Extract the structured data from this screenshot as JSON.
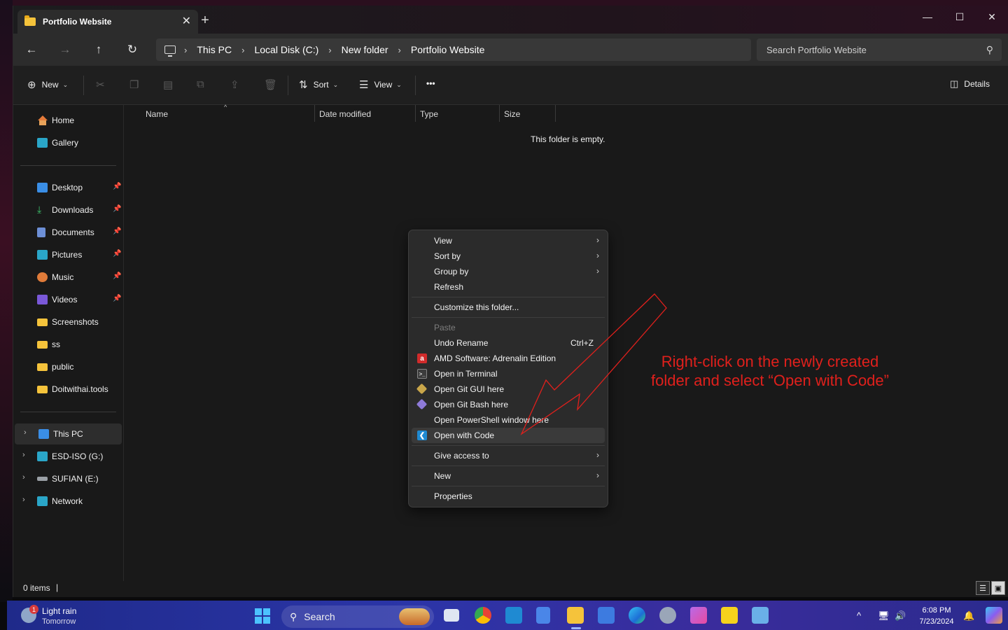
{
  "window": {
    "tab_title": "Portfolio Website",
    "tab_close": "✕",
    "new_tab": "+",
    "controls": {
      "minimize": "—",
      "maximize": "☐",
      "close": "✕"
    }
  },
  "nav": {
    "back": "←",
    "forward": "→",
    "up": "↑",
    "refresh": "↻",
    "breadcrumbs": [
      "This PC",
      "Local Disk (C:)",
      "New folder",
      "Portfolio Website"
    ],
    "crumb_sep": "›",
    "search_placeholder": "Search Portfolio Website",
    "search_icon": "search-icon"
  },
  "toolbar": {
    "new_label": "New",
    "sort_label": "Sort",
    "view_label": "View",
    "more_label": "•••",
    "details_label": "Details"
  },
  "sidebar": {
    "top": [
      {
        "label": "Home",
        "icon": "home-icon"
      },
      {
        "label": "Gallery",
        "icon": "gallery-icon"
      }
    ],
    "quick": [
      {
        "label": "Desktop",
        "pinned": true
      },
      {
        "label": "Downloads",
        "pinned": true
      },
      {
        "label": "Documents",
        "pinned": true
      },
      {
        "label": "Pictures",
        "pinned": true
      },
      {
        "label": "Music",
        "pinned": true
      },
      {
        "label": "Videos",
        "pinned": true
      },
      {
        "label": "Screenshots",
        "pinned": false
      },
      {
        "label": "ss",
        "pinned": false
      },
      {
        "label": "public",
        "pinned": false
      },
      {
        "label": "Doitwithai.tools",
        "pinned": false
      }
    ],
    "drives": [
      {
        "label": "This PC",
        "selected": true
      },
      {
        "label": "ESD-ISO (G:)",
        "selected": false
      },
      {
        "label": "SUFIAN (E:)",
        "selected": false
      },
      {
        "label": "Network",
        "selected": false
      }
    ]
  },
  "columns": [
    "Name",
    "Date modified",
    "Type",
    "Size"
  ],
  "empty_message": "This folder is empty.",
  "status": {
    "items": "0 items",
    "cursor": "|"
  },
  "context_menu": {
    "items": [
      {
        "label": "View",
        "submenu": true
      },
      {
        "label": "Sort by",
        "submenu": true
      },
      {
        "label": "Group by",
        "submenu": true
      },
      {
        "label": "Refresh"
      },
      {
        "label": "Customize this folder..."
      },
      {
        "label": "Paste",
        "disabled": true
      },
      {
        "label": "Undo Rename",
        "shortcut": "Ctrl+Z"
      },
      {
        "label": "AMD Software: Adrenalin Edition",
        "icon": "amd-icon"
      },
      {
        "label": "Open in Terminal",
        "icon": "terminal-icon"
      },
      {
        "label": "Open Git GUI here",
        "icon": "git-icon"
      },
      {
        "label": "Open Git Bash here",
        "icon": "git-icon"
      },
      {
        "label": "Open PowerShell window here"
      },
      {
        "label": "Open with Code",
        "icon": "vscode-icon"
      },
      {
        "label": "Give access to",
        "submenu": true
      },
      {
        "label": "New",
        "submenu": true
      },
      {
        "label": "Properties"
      }
    ]
  },
  "annotation": {
    "line1": "Right-click on the newly created",
    "line2": "folder and select “Open with Code”",
    "color": "#e0201c"
  },
  "taskbar": {
    "weather_title": "Light rain",
    "weather_sub": "Tomorrow",
    "weather_badge": "1",
    "search_label": "Search",
    "time": "6:08 PM",
    "date": "7/23/2024"
  }
}
